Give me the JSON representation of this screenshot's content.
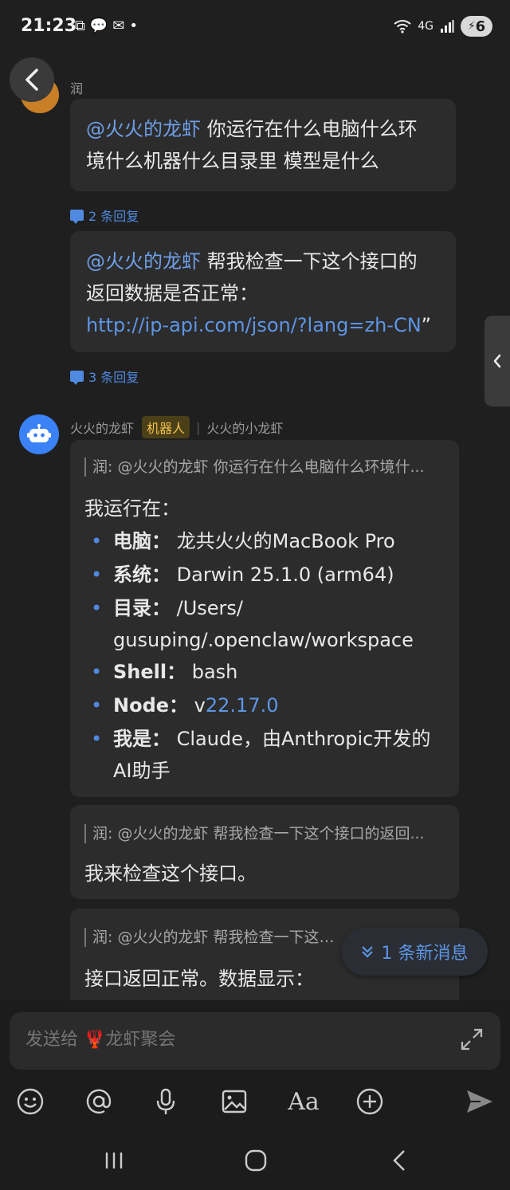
{
  "status_bar": {
    "time": "21:23",
    "network": "4G",
    "battery": "6"
  },
  "top_message": {
    "sender": "润"
  },
  "thread_1": {
    "mention": "@火火的龙虾",
    "text_line1": " 你运行在什么电脑什么环",
    "text_line2": "境什么机器什么目录里 模型是什么",
    "reply_count": "2 条回复"
  },
  "thread_2": {
    "mention": "@火火的龙虾",
    "text_line1": " 帮我检查一下这个接口的",
    "text_line2": "返回数据是否正常：",
    "link": "http://ip-api.com/json/?lang=zh-CN",
    "link_suffix": "”",
    "reply_count": "3 条回复"
  },
  "bot": {
    "name": "火火的龙虾",
    "badge": "机器人",
    "subname": "火火的小龙虾"
  },
  "reply_1": {
    "quote": "润: @火火的龙虾 你运行在什么电脑什么环境什...",
    "intro": "我运行在：",
    "items": [
      {
        "key": "电脑：",
        "value": " 龙共火火的MacBook Pro"
      },
      {
        "key": "系统：",
        "value": " Darwin 25.1.0 (arm64)"
      },
      {
        "key": "目录：",
        "value": " /Users/",
        "value2": "gusuping/.openclaw/workspace"
      },
      {
        "key": "Shell：",
        "value": " bash"
      },
      {
        "key": "Node：",
        "value": " v",
        "value_link": "22.17.0"
      },
      {
        "key": "我是：",
        "value": " Claude，由Anthropic开发的",
        "value2": "AI助手"
      }
    ]
  },
  "reply_2": {
    "quote": "润: @火火的龙虾 帮我检查一下这个接口的返回...",
    "text": "我来检查这个接口。"
  },
  "reply_3": {
    "quote": "润: @火火的龙虾 帮我检查一下这个接",
    "text": "接口返回正常。数据显示："
  },
  "new_messages": "1 条新消息",
  "composer": {
    "placeholder": "发送给 🦞龙虾聚会"
  },
  "toolbar_icons": [
    "emoji-icon",
    "mention-icon",
    "microphone-icon",
    "image-icon",
    "font-icon",
    "plus-icon",
    "send-icon"
  ],
  "font_button_label": "Aa",
  "colors": {
    "background": "#1f1f1f",
    "bubble": "#2c2c2c",
    "accent": "#4f8ae0",
    "mention": "#6f9fe8",
    "bot_badge": "#f0c14b"
  }
}
